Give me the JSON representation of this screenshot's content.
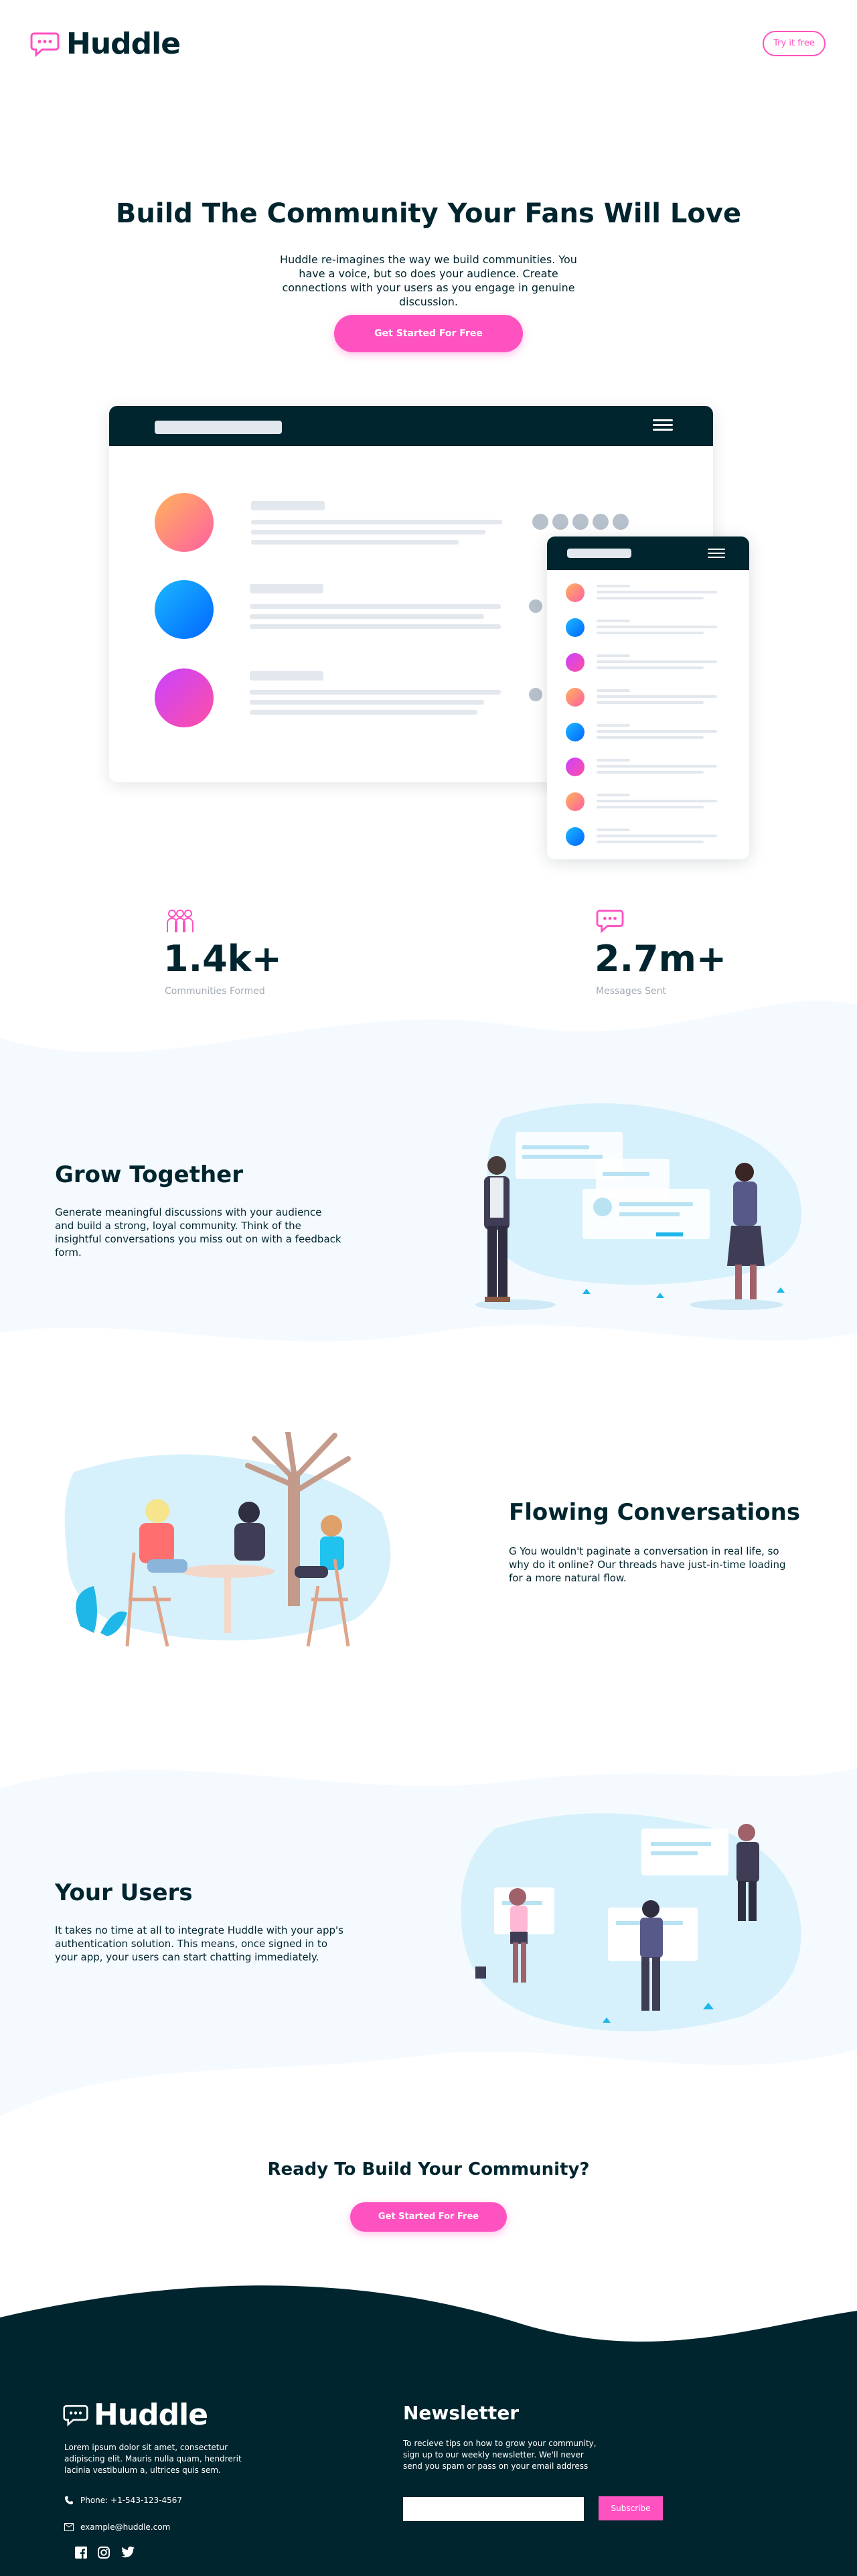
{
  "header": {
    "brand": "Huddle",
    "try_label": "Try it free"
  },
  "hero": {
    "title": "Build The Community Your Fans Will Love",
    "text": "Huddle re-imagines the way we build communities. You have a voice, but so does your audience. Create connections with your users as you engage in genuine discussion.",
    "cta_label": "Get Started For Free"
  },
  "stats": [
    {
      "value": "1.4k+",
      "label": "Communities Formed",
      "icon": "users-icon"
    },
    {
      "value": "2.7m+",
      "label": "Messages Sent",
      "icon": "chat-bubble-icon"
    }
  ],
  "features": [
    {
      "title": "Grow Together",
      "text": "Generate meaningful discussions with your audience and build a strong, loyal community. Think of the insightful conversations you miss out on with a feedback form."
    },
    {
      "title": "Flowing Conversations",
      "text": "G You wouldn't paginate a conversation in real life, so why do it online? Our threads have just-in-time loading for a more natural flow."
    },
    {
      "title": "Your Users",
      "text": "It takes no time at all to integrate Huddle with your app's authentication solution. This means, once signed in to your app, your users can start chatting immediately."
    }
  ],
  "cta": {
    "title": "Ready To Build Your Community?",
    "button_label": "Get Started For Free"
  },
  "footer": {
    "brand": "Huddle",
    "about": "Lorem ipsum dolor sit amet, consectetur adipiscing elit. Mauris nulla quam, hendrerit lacinia vestibulum a, ultrices quis sem.",
    "phone": "Phone: +1-543-123-4567",
    "email": "example@huddle.com",
    "social_icons": [
      "facebook-icon",
      "instagram-icon",
      "twitter-icon"
    ],
    "newsletter_title": "Newsletter",
    "newsletter_text": "To recieve tips on how to grow your community, sign up to our weekly newsletter. We'll never send you spam or pass on your email address",
    "email_input_value": "",
    "subscribe_label": "Subscribe"
  },
  "colors": {
    "primary_dark": "#00252e",
    "accent_pink": "#ff52c1",
    "light_section": "#f5faff",
    "muted_text": "#a3aab3"
  }
}
